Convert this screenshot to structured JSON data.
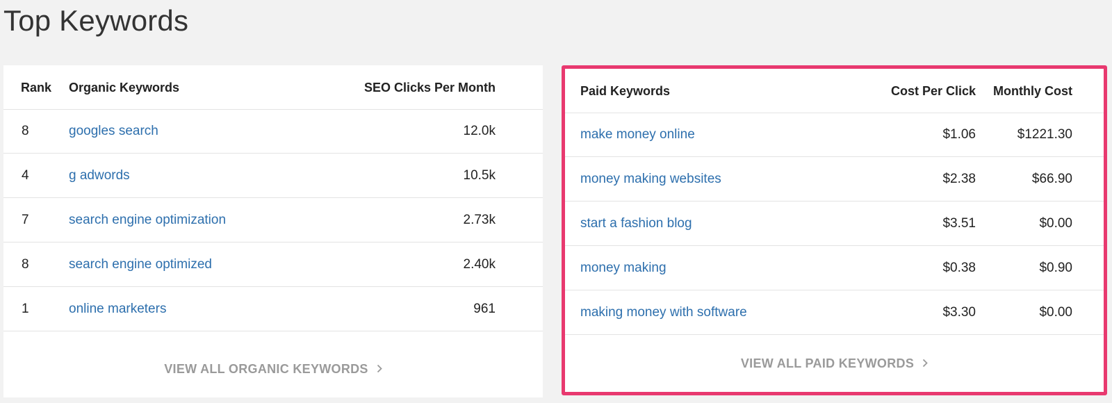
{
  "page_title": "Top Keywords",
  "organic": {
    "headers": {
      "rank": "Rank",
      "keyword": "Organic Keywords",
      "clicks": "SEO Clicks Per Month"
    },
    "rows": [
      {
        "rank": "8",
        "keyword": "googles search",
        "clicks": "12.0k"
      },
      {
        "rank": "4",
        "keyword": "g adwords",
        "clicks": "10.5k"
      },
      {
        "rank": "7",
        "keyword": "search engine optimization",
        "clicks": "2.73k"
      },
      {
        "rank": "8",
        "keyword": "search engine optimized",
        "clicks": "2.40k"
      },
      {
        "rank": "1",
        "keyword": "online marketers",
        "clicks": "961"
      }
    ],
    "view_all": "VIEW ALL ORGANIC KEYWORDS",
    "chevron_icon": "chevron-right-icon"
  },
  "paid": {
    "headers": {
      "keyword": "Paid Keywords",
      "cpc": "Cost Per Click",
      "monthly": "Monthly Cost"
    },
    "rows": [
      {
        "keyword": "make money online",
        "cpc": "$1.06",
        "monthly": "$1221.30"
      },
      {
        "keyword": "money making websites",
        "cpc": "$2.38",
        "monthly": "$66.90"
      },
      {
        "keyword": "start a fashion blog",
        "cpc": "$3.51",
        "monthly": "$0.00"
      },
      {
        "keyword": "money making",
        "cpc": "$0.38",
        "monthly": "$0.90"
      },
      {
        "keyword": "making money with software",
        "cpc": "$3.30",
        "monthly": "$0.00"
      }
    ],
    "view_all": "VIEW ALL PAID KEYWORDS",
    "chevron_icon": "chevron-right-icon",
    "highlight_color": "#e8396f"
  },
  "colors": {
    "link": "#2d6fad",
    "background": "#f2f2f2",
    "footer_link": "#9a9a9a"
  }
}
